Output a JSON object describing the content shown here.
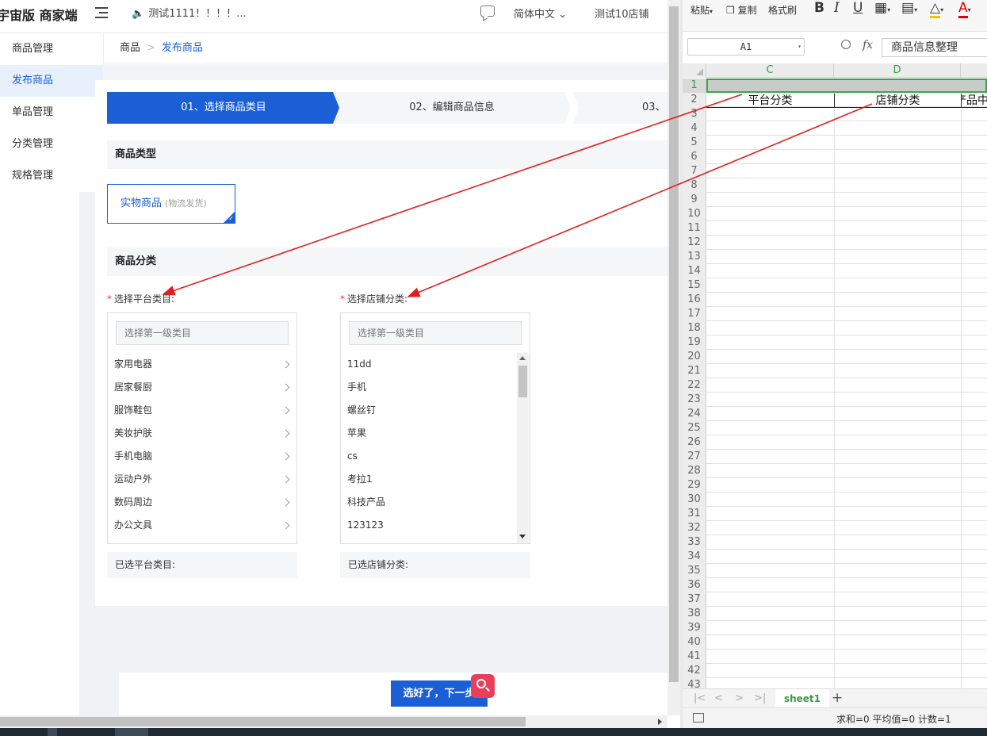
{
  "header": {
    "logo": "宇宙版 商家端",
    "notice": "测试1111！！！！...",
    "language": "简体中文",
    "store": "测试10店铺"
  },
  "sidebar": {
    "items": [
      {
        "label": "商品管理",
        "active": false
      },
      {
        "label": "发布商品",
        "active": true
      },
      {
        "label": "单品管理",
        "active": false
      },
      {
        "label": "分类管理",
        "active": false
      },
      {
        "label": "规格管理",
        "active": false
      }
    ]
  },
  "breadcrumb": {
    "root": "商品",
    "current": "发布商品"
  },
  "steps": [
    {
      "label": "01、选择商品类目",
      "active": true
    },
    {
      "label": "02、编辑商品信息",
      "active": false
    },
    {
      "label": "03、",
      "active": false
    }
  ],
  "product_type": {
    "title": "商品类型",
    "option_label": "实物商品",
    "option_sub": "(物流发货)"
  },
  "product_category": {
    "title": "商品分类",
    "platform": {
      "label": "选择平台类目:",
      "placeholder": "选择第一级类目",
      "items": [
        "家用电器",
        "居家餐厨",
        "服饰鞋包",
        "美妆护肤",
        "手机电脑",
        "运动户外",
        "数码周边",
        "办公文具"
      ],
      "selected_label": "已选平台类目:"
    },
    "store": {
      "label": "选择店铺分类:",
      "placeholder": "选择第一级类目",
      "items": [
        "11dd",
        "手机",
        "螺丝钉",
        "苹果",
        "cs",
        "考拉1",
        "科技产品",
        "123123"
      ],
      "selected_label": "已选店铺分类:"
    }
  },
  "next_button": "选好了，下一步",
  "spreadsheet": {
    "ribbon": {
      "paste": "粘贴",
      "copy": "复制",
      "format_painter": "格式刷",
      "bold": "B",
      "italic": "I",
      "underline": "U"
    },
    "name_box": "A1",
    "fx": "fx",
    "formula_value": "商品信息整理",
    "columns": [
      "C",
      "D",
      ""
    ],
    "rows": [
      "1",
      "2",
      "3",
      "4",
      "5",
      "6",
      "7",
      "8",
      "9",
      "10",
      "11",
      "12",
      "13",
      "14",
      "15",
      "16",
      "17",
      "18",
      "19",
      "20",
      "21",
      "22",
      "23",
      "24",
      "25",
      "26",
      "27",
      "28",
      "29",
      "30",
      "31",
      "32",
      "33",
      "34",
      "35",
      "36",
      "37",
      "38",
      "39",
      "40",
      "41",
      "42",
      "43"
    ],
    "row2": {
      "c": "平台分类",
      "d": "店铺分类",
      "e": "产品中"
    },
    "sheet_tab": "sheet1",
    "status": "求和=0   平均值=0   计数=1"
  },
  "colors": {
    "primary": "#1a5fd6",
    "annotation_arrow": "#e02020",
    "excel_green": "#3a9a4a"
  }
}
